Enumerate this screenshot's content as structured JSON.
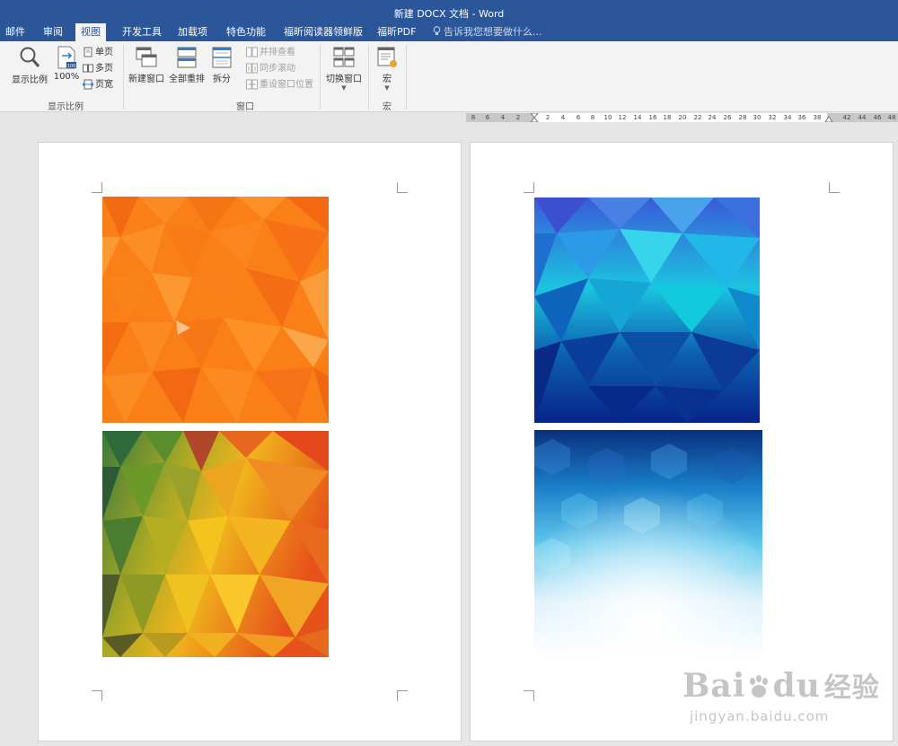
{
  "window": {
    "title": "新建 DOCX 文档 - Word"
  },
  "tabs": [
    {
      "label": "邮件"
    },
    {
      "label": "审阅"
    },
    {
      "label": "视图",
      "active": true
    },
    {
      "label": "开发工具"
    },
    {
      "label": "加载项"
    },
    {
      "label": "特色功能"
    },
    {
      "label": "福昕阅读器领鲜版"
    },
    {
      "label": "福昕PDF"
    }
  ],
  "tell_me": {
    "placeholder": "告诉我您想要做什么..."
  },
  "ribbon": {
    "zoom_group": {
      "label": "显示比例",
      "zoom_label": "显示比例",
      "hundred_label": "100%",
      "hundred_badge": "100",
      "one_page": "单页",
      "multi_page": "多页",
      "page_width": "页宽"
    },
    "window_group": {
      "label": "窗口",
      "new_window": "新建窗口",
      "arrange_all": "全部重排",
      "split": "拆分",
      "side_by_side": "并排查看",
      "sync_scroll": "同步滚动",
      "reset_position": "重设窗口位置",
      "switch_window": "切换窗口"
    },
    "macro_group": {
      "label": "宏",
      "macros": "宏"
    }
  },
  "ruler": {
    "ticks": [
      "8",
      "6",
      "4",
      "2",
      "2",
      "4",
      "6",
      "8",
      "10",
      "12",
      "14",
      "16",
      "18",
      "20",
      "22",
      "24",
      "26",
      "28",
      "30",
      "32",
      "34",
      "36",
      "38",
      "42",
      "44",
      "46",
      "48"
    ]
  },
  "watermark": {
    "logo_a": "Bai",
    "logo_b": "du",
    "logo_c": "经验",
    "url": "jingyan.baidu.com"
  },
  "colors": {
    "title_bar": "#2b579a",
    "ribbon_bg": "#f3f3f3",
    "workspace_bg": "#e6e6e6"
  }
}
